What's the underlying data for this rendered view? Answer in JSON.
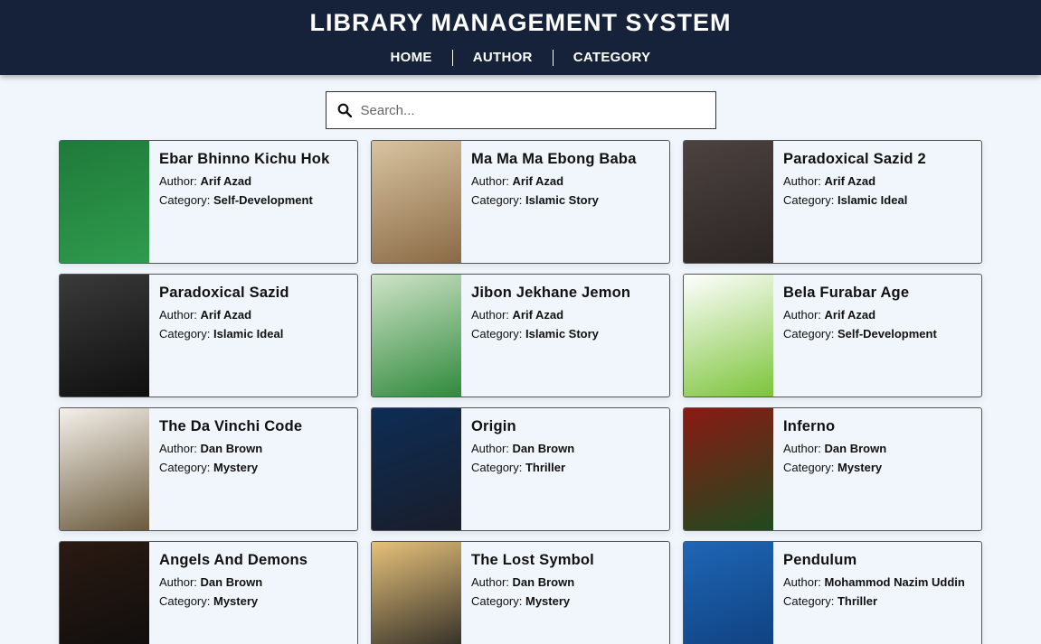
{
  "header": {
    "title": "LIBRARY MANAGEMENT SYSTEM"
  },
  "nav": [
    {
      "label": "HOME"
    },
    {
      "label": "AUTHOR"
    },
    {
      "label": "CATEGORY"
    }
  ],
  "search": {
    "placeholder": "Search...",
    "icon": "search-icon"
  },
  "labels": {
    "author": "Author: ",
    "category": "Category: "
  },
  "books": [
    {
      "title": "Ebar Bhinno Kichu Hok",
      "author": "Arif Azad",
      "category": "Self-Development",
      "cover_colors": [
        "#1f7a3a",
        "#2f9b4d"
      ]
    },
    {
      "title": "Ma Ma Ma Ebong Baba",
      "author": "Arif Azad",
      "category": "Islamic Story",
      "cover_colors": [
        "#d8c3a0",
        "#8a6a45"
      ]
    },
    {
      "title": "Paradoxical Sazid 2",
      "author": "Arif Azad",
      "category": "Islamic Ideal",
      "cover_colors": [
        "#4c4340",
        "#2b2524"
      ]
    },
    {
      "title": "Paradoxical Sazid",
      "author": "Arif Azad",
      "category": "Islamic Ideal",
      "cover_colors": [
        "#3a3a3a",
        "#0f0f0f"
      ]
    },
    {
      "title": "Jibon Jekhane Jemon",
      "author": "Arif Azad",
      "category": "Islamic Story",
      "cover_colors": [
        "#cfe3c8",
        "#2f8a3c"
      ]
    },
    {
      "title": "Bela Furabar Age",
      "author": "Arif Azad",
      "category": "Self-Development",
      "cover_colors": [
        "#ffffff",
        "#7cc43a"
      ]
    },
    {
      "title": "The Da Vinchi Code",
      "author": "Dan Brown",
      "category": "Mystery",
      "cover_colors": [
        "#f4f0ea",
        "#6a5a3c"
      ]
    },
    {
      "title": "Origin",
      "author": "Dan Brown",
      "category": "Thriller",
      "cover_colors": [
        "#0d2d55",
        "#1a1d2a"
      ]
    },
    {
      "title": "Inferno",
      "author": "Dan Brown",
      "category": "Mystery",
      "cover_colors": [
        "#8a1a14",
        "#1f4a1f"
      ]
    },
    {
      "title": "Angels And Demons",
      "author": "Dan Brown",
      "category": "Mystery",
      "cover_colors": [
        "#2a1a12",
        "#0d0d0d"
      ]
    },
    {
      "title": "The Lost Symbol",
      "author": "Dan Brown",
      "category": "Mystery",
      "cover_colors": [
        "#e6c27a",
        "#1e1e1e"
      ]
    },
    {
      "title": "Pendulum",
      "author": "Mohammod Nazim Uddin",
      "category": "Thriller",
      "cover_colors": [
        "#1f66b5",
        "#0e3d7a"
      ]
    }
  ]
}
